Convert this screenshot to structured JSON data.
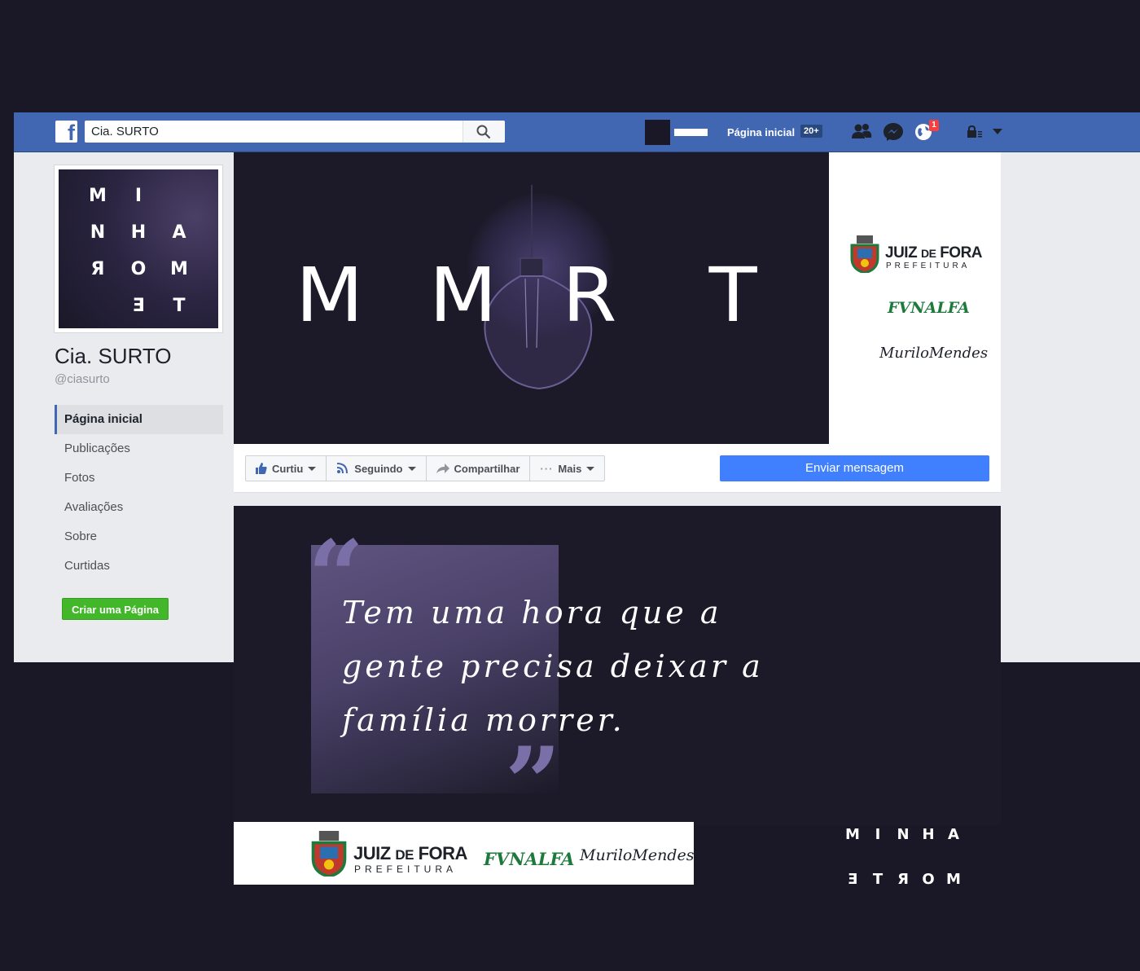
{
  "topbar": {
    "search_value": "Cia. SURTO",
    "home_label": "Página inicial",
    "home_badge": "20+",
    "notification_count": "1",
    "brand_color": "#4267b2"
  },
  "profile": {
    "picture_letters": [
      "M",
      "I",
      "N",
      "H",
      "A",
      "Я",
      "O",
      "M",
      "Ǝ",
      "T"
    ],
    "name": "Cia. SURTO",
    "handle": "@ciasurto"
  },
  "sidebar": {
    "items": [
      {
        "label": "Página inicial",
        "active": true
      },
      {
        "label": "Publicações"
      },
      {
        "label": "Fotos"
      },
      {
        "label": "Avaliações"
      },
      {
        "label": "Sobre"
      },
      {
        "label": "Curtidas"
      }
    ],
    "create_page_label": "Criar uma Página"
  },
  "cover": {
    "letters": [
      "M",
      "M",
      "R",
      "T"
    ],
    "sponsors": {
      "jf_title_a": "JUIZ",
      "jf_title_b": "DE",
      "jf_title_c": "FORA",
      "jf_subtitle": "PREFEITURA",
      "funalfa": "FVNALFA",
      "signature": "MuriloMendes"
    }
  },
  "actions": {
    "liked_label": "Curtiu",
    "following_label": "Seguindo",
    "share_label": "Compartilhar",
    "more_label": "Mais",
    "send_message_label": "Enviar mensagem"
  },
  "quote": {
    "lines": [
      "Tem uma hora que a",
      "gente precisa deixar a",
      "família morrer."
    ],
    "open_mark": "“",
    "close_mark": "”"
  },
  "bottom_strip": {
    "jf_title_a": "JUIZ",
    "jf_title_b": "DE",
    "jf_title_c": "FORA",
    "jf_subtitle": "PREFEITURA",
    "funalfa": "FVNALFA",
    "signature": "MuriloMendes"
  },
  "corner_logo": {
    "row1": [
      "M",
      "I",
      "N",
      "H",
      "A"
    ],
    "row2": [
      "Ǝ",
      "T",
      "Я",
      "O",
      "M"
    ]
  }
}
